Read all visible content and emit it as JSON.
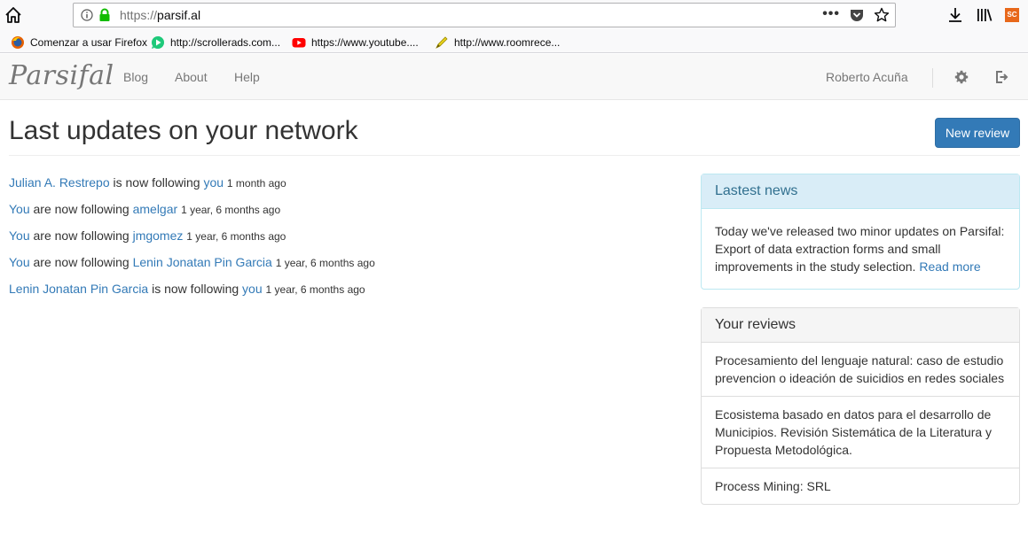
{
  "browser": {
    "url_protocol": "https://",
    "url_host": "parsif.al",
    "menu_dots": "•••",
    "sc_badge": "SC",
    "bookmarks": [
      {
        "label": "Comenzar a usar Firefox",
        "icon": "firefox-icon"
      },
      {
        "label": "http://scrollerads.com...",
        "icon": "scrollerads-icon"
      },
      {
        "label": "https://www.youtube....",
        "icon": "youtube-icon"
      },
      {
        "label": "http://www.roomrece...",
        "icon": "pen-icon"
      }
    ]
  },
  "navbar": {
    "brand": "Parsifal",
    "links": [
      "Blog",
      "About",
      "Help"
    ],
    "user": "Roberto Acuña"
  },
  "main": {
    "title": "Last updates on your network",
    "new_review_label": "New review",
    "activity": [
      {
        "actor": "Julian A. Restrepo",
        "verb": " is now following ",
        "target": "you",
        "time": "1 month ago"
      },
      {
        "actor": "You",
        "verb": " are now following ",
        "target": "amelgar",
        "time": "1 year, 6 months ago"
      },
      {
        "actor": "You",
        "verb": " are now following ",
        "target": "jmgomez",
        "time": "1 year, 6 months ago"
      },
      {
        "actor": "You",
        "verb": " are now following ",
        "target": "Lenin Jonatan Pin Garcia",
        "time": "1 year, 6 months ago"
      },
      {
        "actor": "Lenin Jonatan Pin Garcia",
        "verb": " is now following ",
        "target": "you",
        "time": "1 year, 6 months ago"
      }
    ]
  },
  "news": {
    "heading": "Lastest news",
    "body": "Today we've released two minor updates on Parsifal: Export of data extraction forms and small improvements in the study selection.",
    "read_more": "Read more"
  },
  "reviews": {
    "heading": "Your reviews",
    "items": [
      "Procesamiento del lenguaje natural: caso de estudio prevencion o ideación de suicidios en redes sociales",
      "Ecosistema basado en datos para el desarrollo de Municipios. Revisión Sistemática de la Literatura y Propuesta Metodológica.",
      "Process Mining: SRL"
    ]
  },
  "colors": {
    "link": "#337ab7",
    "primary_button": "#337ab7",
    "info_heading_bg": "#d9edf7",
    "info_heading_text": "#31708f"
  }
}
